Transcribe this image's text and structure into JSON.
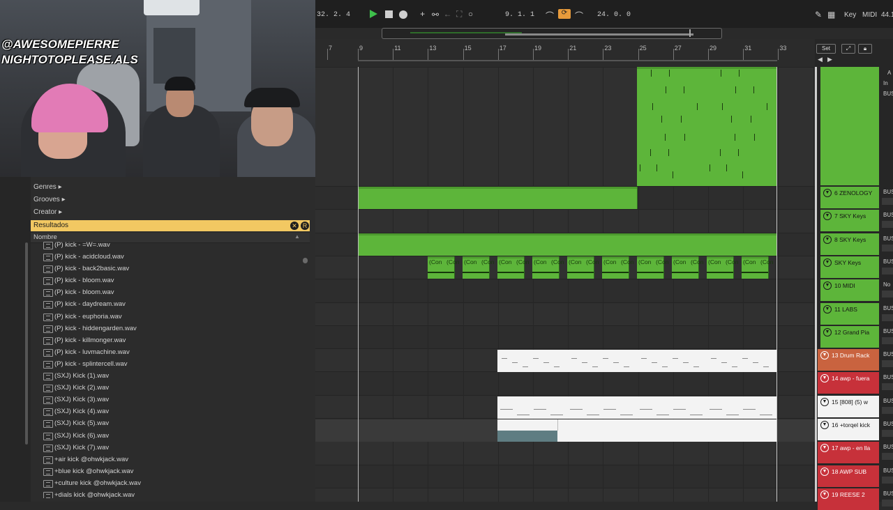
{
  "webcam": {
    "overlay_line1": "@AWESOMEPIERRE",
    "overlay_line2": "NIGHTOTOPLEASE.ALS"
  },
  "browser": {
    "categories": [
      "Genres ▸",
      "Grooves ▸",
      "Creator ▸"
    ],
    "results_label": "Resultados",
    "column_header": "Nombre",
    "files": [
      "(P) kick - =W=.wav",
      "(P) kick - acidcloud.wav",
      "(P) kick - back2basic.wav",
      "(P) kick - bloom.wav",
      "(P) kick - bloom.wav",
      "(P) kick - daydream.wav",
      "(P) kick - euphoria.wav",
      "(P) kick - hiddengarden.wav",
      "(P) kick - killmonger.wav",
      "(P) kick - luvmachine.wav",
      "(P) kick - splintercell.wav",
      "(SXJ) Kick (1).wav",
      "(SXJ) Kick (2).wav",
      "(SXJ) Kick (3).wav",
      "(SXJ) Kick (4).wav",
      "(SXJ) Kick (5).wav",
      "(SXJ) Kick (6).wav",
      "(SXJ) Kick (7).wav",
      "+air kick @ohwkjack.wav",
      "+blue kick @ohwkjack.wav",
      "+culture kick @ohwkjack.wav",
      "+dials kick @ohwkjack.wav"
    ]
  },
  "transport": {
    "position": "32.  2.  4",
    "loop_start": "9.  1.  1",
    "loop_length": "24.  0.  0",
    "key_label": "Key",
    "midi_label": "MIDI",
    "sample_rate": "44.1"
  },
  "ruler": {
    "bars": [
      "7",
      "9",
      "11",
      "13",
      "15",
      "17",
      "19",
      "21",
      "23",
      "25",
      "27",
      "29",
      "31",
      "33"
    ]
  },
  "track_panel": {
    "set_label": "Set"
  },
  "tracks": [
    {
      "name": "",
      "color": "#5db53a",
      "io": ""
    },
    {
      "name": "6 ZENOLOGY",
      "color": "#5db53a",
      "io": "BUS"
    },
    {
      "name": "7 SKY Keys",
      "color": "#5db53a",
      "io": "BUS"
    },
    {
      "name": "8 SKY Keys",
      "color": "#5db53a",
      "io": "BUS"
    },
    {
      "name": "SKY Keys",
      "color": "#5db53a",
      "io": "BUS"
    },
    {
      "name": "10 MIDI",
      "color": "#5db53a",
      "io": "No"
    },
    {
      "name": "11 LABS",
      "color": "#5db53a",
      "io": "BUS"
    },
    {
      "name": "12 Grand Pia",
      "color": "#5db53a",
      "io": "BUS"
    },
    {
      "name": "13 Drum Rack",
      "color": "#c9633f",
      "io": "BUS"
    },
    {
      "name": "14 awp - fuera",
      "color": "#c7313a",
      "io": "BUS"
    },
    {
      "name": "15 [808] (5) w",
      "color": "#f3f3f3",
      "io": "BUS"
    },
    {
      "name": "16 +torqel kick",
      "color": "#f3f3f3",
      "io": "BUS"
    },
    {
      "name": "17 awp - en lla",
      "color": "#c7313a",
      "io": "BUS"
    },
    {
      "name": "18 AWP SUB",
      "color": "#c7313a",
      "io": "BUS"
    },
    {
      "name": "19 REESE 2",
      "color": "#c7313a",
      "io": "BUS"
    }
  ],
  "top_track_io": [
    "A",
    "In",
    "BUS"
  ],
  "clip_label": "(Con"
}
